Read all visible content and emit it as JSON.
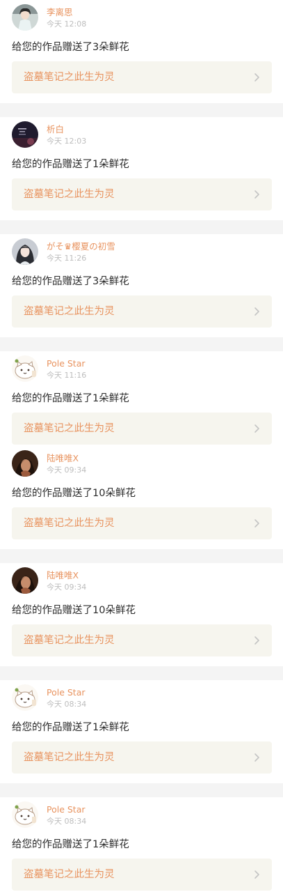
{
  "colors": {
    "accent": "#e8935f",
    "time": "#bdbdbd",
    "text": "#2a2a2a",
    "work_bg": "#f6f5ee",
    "divider": "#f4f4f4"
  },
  "icons": {
    "chevron": "chevron-right-icon"
  },
  "notifications": [
    {
      "user": "李离思",
      "time": "今天 12:08",
      "message": "给您的作品赠送了3朵鲜花",
      "work_title": "盗墓笔记之此生为灵",
      "avatar": "woman-portrait"
    },
    {
      "user": "析白",
      "time": "今天 12:03",
      "message": "给您的作品赠送了1朵鲜花",
      "work_title": "盗墓笔记之此生为灵",
      "avatar": "night-poster"
    },
    {
      "user": "がそ♛樱夏の初雪",
      "time": "今天 11:26",
      "message": "给您的作品赠送了3朵鲜花",
      "work_title": "盗墓笔记之此生为灵",
      "avatar": "girl-portrait"
    },
    {
      "user": "Pole Star",
      "time": "今天 11:16",
      "message": "给您的作品赠送了1朵鲜花",
      "work_title": "盗墓笔记之此生为灵",
      "avatar": "cartoon-cat"
    },
    {
      "user": "陆唯唯X",
      "time": "今天 09:34",
      "message": "给您的作品赠送了10朵鲜花",
      "work_title": "盗墓笔记之此生为灵",
      "avatar": "dark-portrait"
    },
    {
      "user": "陆唯唯X",
      "time": "今天 09:34",
      "message": "给您的作品赠送了10朵鲜花",
      "work_title": "盗墓笔记之此生为灵",
      "avatar": "dark-portrait"
    },
    {
      "user": "Pole Star",
      "time": "今天 08:34",
      "message": "给您的作品赠送了1朵鲜花",
      "work_title": "盗墓笔记之此生为灵",
      "avatar": "cartoon-cat"
    },
    {
      "user": "Pole Star",
      "time": "今天 08:34",
      "message": "给您的作品赠送了1朵鲜花",
      "work_title": "盗墓笔记之此生为灵",
      "avatar": "cartoon-cat"
    }
  ]
}
